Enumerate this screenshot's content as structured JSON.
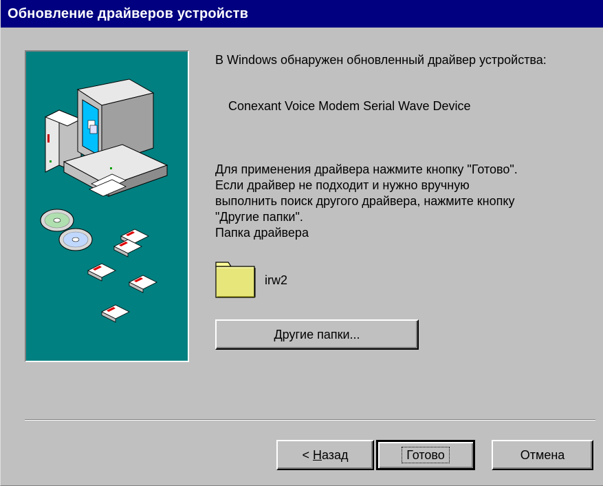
{
  "window": {
    "title": "Обновление драйверов устройств"
  },
  "content": {
    "found_line": "В Windows обнаружен обновленный драйвер устройства:",
    "device_name": "Conexant Voice Modem Serial Wave Device",
    "instructions_line1": "Для применения драйвера нажмите кнопку \"Готово\".",
    "instructions_line2": "Если драйвер не подходит и нужно вручную",
    "instructions_line3": "выполнить поиск другого драйвера, нажмите кнопку",
    "instructions_line4": "\"Другие папки\".",
    "folder_label": "Папка драйвера",
    "folder_name": "irw2",
    "folder_icon": "folder-icon"
  },
  "buttons": {
    "browse_first": "Д",
    "browse_rest": "ругие папки...",
    "back_prefix": "< ",
    "back_underlined": "Н",
    "back_rest": "азад",
    "finish": "Готово",
    "cancel": "Отмена"
  },
  "colors": {
    "titlebar": "#000080",
    "panel": "#008080",
    "face": "#c0c0c0"
  }
}
